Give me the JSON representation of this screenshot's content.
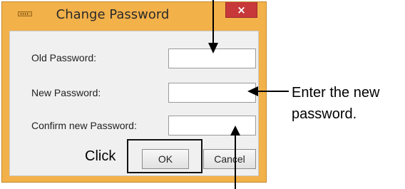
{
  "dialog": {
    "title": "Change Password",
    "close_label": "×",
    "fields": [
      {
        "label": "Old Password:",
        "value": ""
      },
      {
        "label": "New Password:",
        "value": ""
      },
      {
        "label": "Confirm new Password:",
        "value": ""
      }
    ],
    "ok_label": "OK",
    "cancel_label": "Cancel"
  },
  "annotations": {
    "enter_new": "Enter the new",
    "password_word": "password.",
    "click": "Click"
  }
}
